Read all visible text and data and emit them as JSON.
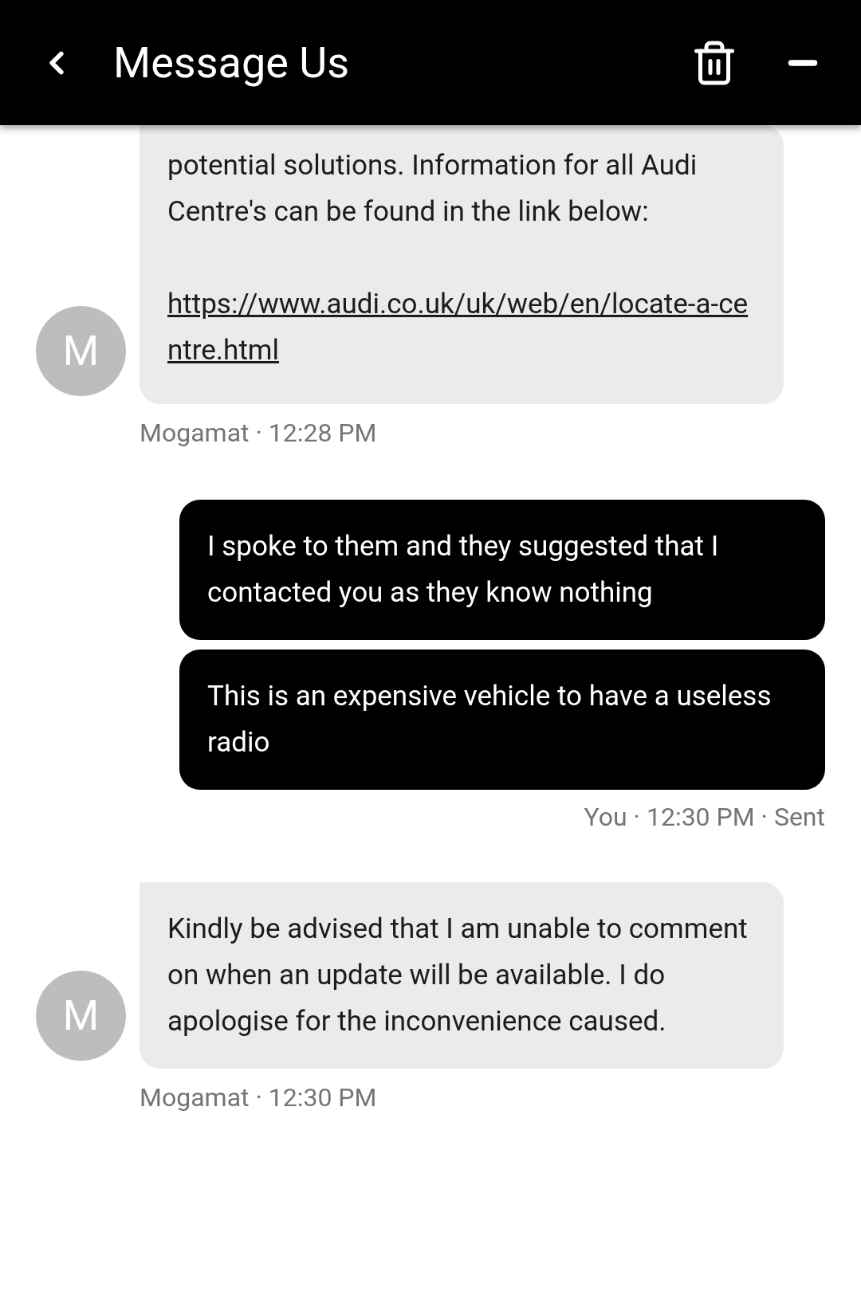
{
  "header": {
    "title": "Message Us"
  },
  "groups": [
    {
      "kind": "incoming",
      "avatar": "M",
      "bubbles": [
        {
          "text": "potential solutions. Information for all Audi Centre's can be found in the link below:",
          "link": "https://www.audi.co.uk/uk/web/en/locate-a-centre.html"
        }
      ],
      "meta": "Mogamat · 12:28 PM"
    },
    {
      "kind": "outgoing",
      "bubbles": [
        {
          "text": "I spoke to them and they suggested that I contacted you as they know nothing"
        },
        {
          "text": "This is an expensive vehicle to have a useless radio"
        }
      ],
      "meta": "You · 12:30 PM · Sent"
    },
    {
      "kind": "incoming",
      "avatar": "M",
      "bubbles": [
        {
          "text": "Kindly be advised that I am unable to comment on when an update will be available. I do apologise for the inconvenience caused."
        }
      ],
      "meta": "Mogamat · 12:30 PM"
    }
  ]
}
